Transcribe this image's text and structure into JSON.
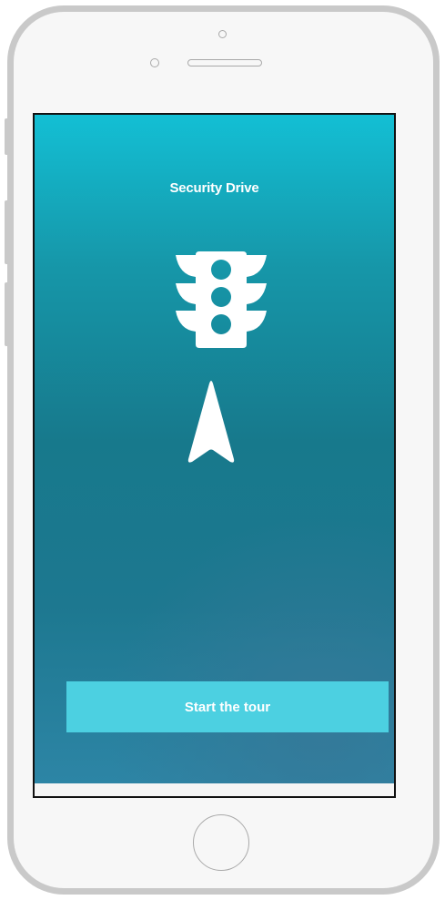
{
  "app": {
    "title": "Security Drive"
  },
  "icons": {
    "main": "traffic-light-icon",
    "secondary": "navigation-arrow-icon"
  },
  "cta": {
    "label": "Start the tour"
  },
  "colors": {
    "gradient_top": "#13bfd4",
    "gradient_mid": "#17798c",
    "gradient_bottom": "#2e86a7",
    "button": "#4cd0e1",
    "text": "#ffffff",
    "device_frame": "#c9c9c9"
  }
}
